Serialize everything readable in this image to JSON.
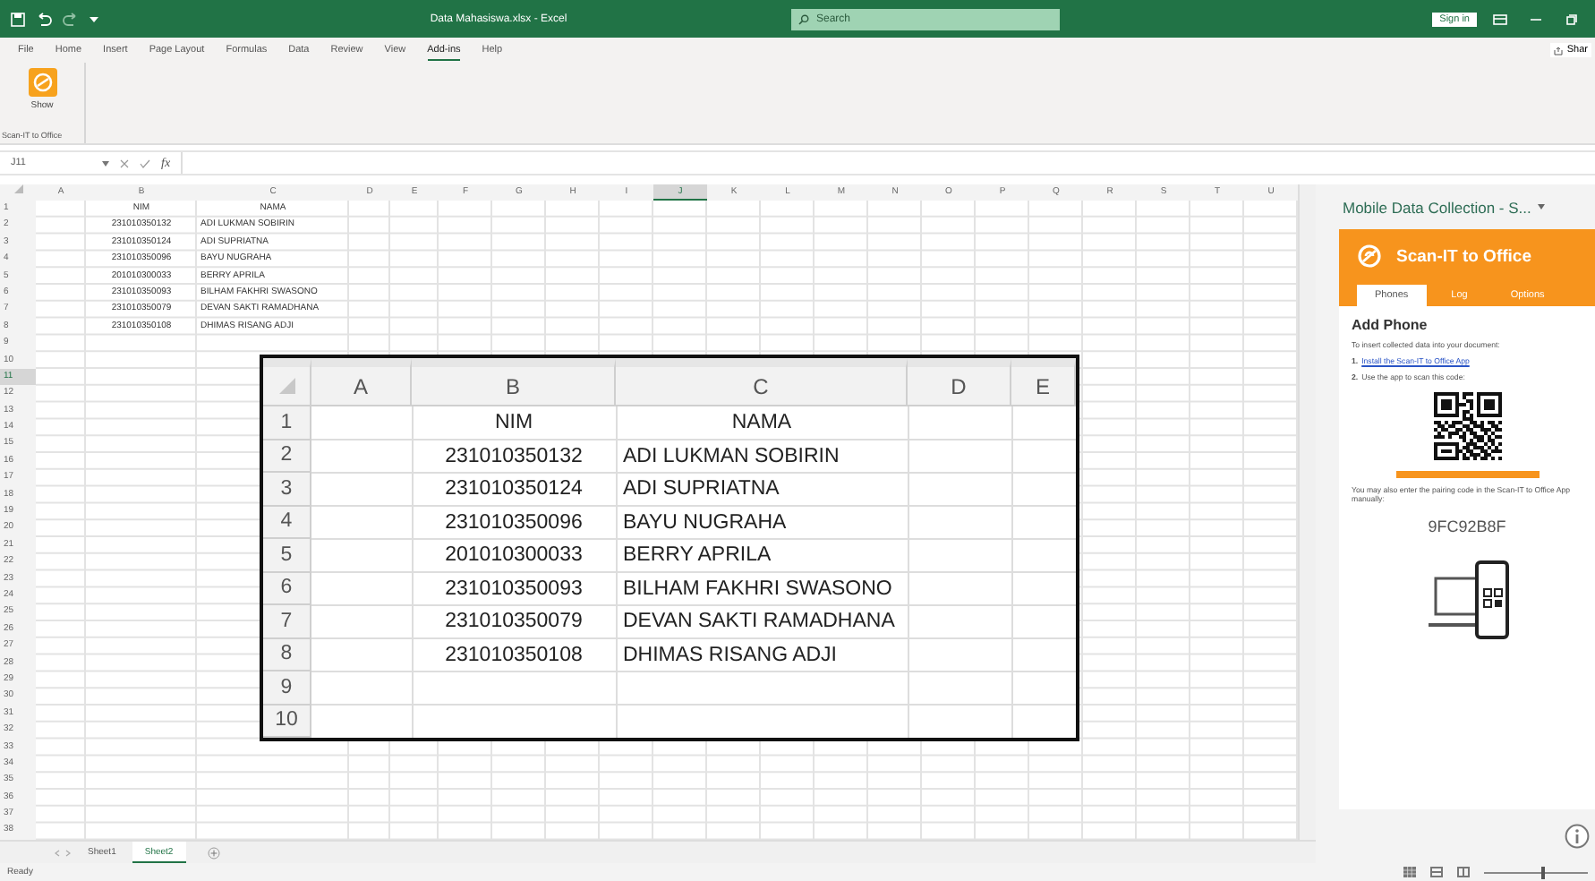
{
  "window": {
    "title": "Data Mahasiswa.xlsx - Excel",
    "search_placeholder": "Search",
    "sign_in": "Sign in"
  },
  "ribbon_tabs": [
    {
      "label": "File",
      "selected": false
    },
    {
      "label": "Home",
      "selected": false
    },
    {
      "label": "Insert",
      "selected": false
    },
    {
      "label": "Page Layout",
      "selected": false
    },
    {
      "label": "Formulas",
      "selected": false
    },
    {
      "label": "Data",
      "selected": false
    },
    {
      "label": "Review",
      "selected": false
    },
    {
      "label": "View",
      "selected": false
    },
    {
      "label": "Add-ins",
      "selected": true
    },
    {
      "label": "Help",
      "selected": false
    }
  ],
  "share": "Shar",
  "ribbon": {
    "button": "Show",
    "group": "Scan-IT to Office"
  },
  "formula_bar": {
    "name_box": "J11",
    "function_label": "fx"
  },
  "sheet": {
    "columns": [
      {
        "label": "A",
        "selected": false
      },
      {
        "label": "B",
        "selected": false
      },
      {
        "label": "C",
        "selected": false
      },
      {
        "label": "D",
        "selected": false
      },
      {
        "label": "E",
        "selected": false
      },
      {
        "label": "F",
        "selected": false
      },
      {
        "label": "G",
        "selected": false
      },
      {
        "label": "H",
        "selected": false
      },
      {
        "label": "I",
        "selected": false
      },
      {
        "label": "J",
        "selected": true
      },
      {
        "label": "K",
        "selected": false
      },
      {
        "label": "L",
        "selected": false
      },
      {
        "label": "M",
        "selected": false
      },
      {
        "label": "N",
        "selected": false
      },
      {
        "label": "O",
        "selected": false
      },
      {
        "label": "P",
        "selected": false
      },
      {
        "label": "Q",
        "selected": false
      },
      {
        "label": "R",
        "selected": false
      },
      {
        "label": "S",
        "selected": false
      },
      {
        "label": "T",
        "selected": false
      },
      {
        "label": "U",
        "selected": false
      }
    ],
    "rows": [
      {
        "number": "1",
        "selected": false,
        "cells": [
          "",
          "NIM",
          "NAMA"
        ]
      },
      {
        "number": "2",
        "selected": false,
        "cells": [
          "",
          "231010350132",
          "ADI LUKMAN SOBIRIN"
        ]
      },
      {
        "number": "3",
        "selected": false,
        "cells": [
          "",
          "231010350124",
          "ADI SUPRIATNA"
        ]
      },
      {
        "number": "4",
        "selected": false,
        "cells": [
          "",
          "231010350096",
          "BAYU NUGRAHA"
        ]
      },
      {
        "number": "5",
        "selected": false,
        "cells": [
          "",
          "201010300033",
          "BERRY APRILA"
        ]
      },
      {
        "number": "6",
        "selected": false,
        "cells": [
          "",
          "231010350093",
          "BILHAM FAKHRI SWASONO"
        ]
      },
      {
        "number": "7",
        "selected": false,
        "cells": [
          "",
          "231010350079",
          "DEVAN SAKTI RAMADHANA"
        ]
      },
      {
        "number": "8",
        "selected": false,
        "cells": [
          "",
          "231010350108",
          "DHIMAS RISANG ADJI"
        ]
      },
      {
        "number": "9",
        "selected": false
      },
      {
        "number": "10",
        "selected": false
      },
      {
        "number": "11",
        "selected": true
      },
      {
        "number": "12",
        "selected": false
      },
      {
        "number": "13",
        "selected": false
      },
      {
        "number": "14",
        "selected": false
      },
      {
        "number": "15",
        "selected": false
      },
      {
        "number": "16",
        "selected": false
      },
      {
        "number": "17",
        "selected": false
      },
      {
        "number": "18",
        "selected": false
      },
      {
        "number": "19",
        "selected": false
      },
      {
        "number": "20",
        "selected": false
      },
      {
        "number": "21",
        "selected": false
      },
      {
        "number": "22",
        "selected": false
      },
      {
        "number": "23",
        "selected": false
      },
      {
        "number": "24",
        "selected": false
      },
      {
        "number": "25",
        "selected": false
      },
      {
        "number": "26",
        "selected": false
      },
      {
        "number": "27",
        "selected": false
      },
      {
        "number": "28",
        "selected": false
      },
      {
        "number": "29",
        "selected": false
      },
      {
        "number": "30",
        "selected": false
      },
      {
        "number": "31",
        "selected": false
      },
      {
        "number": "32",
        "selected": false
      },
      {
        "number": "33",
        "selected": false
      },
      {
        "number": "34",
        "selected": false
      },
      {
        "number": "35",
        "selected": false
      },
      {
        "number": "36",
        "selected": false
      },
      {
        "number": "37",
        "selected": false
      },
      {
        "number": "38",
        "selected": false
      }
    ]
  },
  "inset": {
    "columns": [
      "A",
      "B",
      "C",
      "D",
      "E"
    ],
    "rows": [
      {
        "number": "1",
        "cells": [
          "",
          "NIM",
          "NAMA"
        ]
      },
      {
        "number": "2",
        "cells": [
          "",
          "231010350132",
          "ADI LUKMAN SOBIRIN"
        ]
      },
      {
        "number": "3",
        "cells": [
          "",
          "231010350124",
          "ADI SUPRIATNA"
        ]
      },
      {
        "number": "4",
        "cells": [
          "",
          "231010350096",
          "BAYU NUGRAHA"
        ]
      },
      {
        "number": "5",
        "cells": [
          "",
          "201010300033",
          "BERRY APRILA"
        ]
      },
      {
        "number": "6",
        "cells": [
          "",
          "231010350093",
          "BILHAM FAKHRI SWASONO"
        ]
      },
      {
        "number": "7",
        "cells": [
          "",
          "231010350079",
          "DEVAN SAKTI RAMADHANA"
        ]
      },
      {
        "number": "8",
        "cells": [
          "",
          "231010350108",
          "DHIMAS RISANG ADJI"
        ]
      },
      {
        "number": "9",
        "cells": []
      },
      {
        "number": "10",
        "cells": []
      }
    ]
  },
  "task_pane": {
    "title": "Mobile Data Collection - S...",
    "header": "Scan-IT to Office",
    "tabs": [
      {
        "label": "Phones",
        "selected": true
      },
      {
        "label": "Log",
        "selected": false
      },
      {
        "label": "Options",
        "selected": false
      }
    ],
    "heading": "Add Phone",
    "intro": "To insert collected data into your document:",
    "steps": [
      {
        "number": "1.",
        "text": "Install the Scan-IT to Office App",
        "kind": "link"
      },
      {
        "number": "2.",
        "text": "Use the app to scan this code:",
        "kind": "text"
      }
    ],
    "note": "You may also enter the pairing code in the Scan-IT to Office App manually:",
    "pairing_code": "9FC92B8F"
  },
  "sheet_tabs": [
    {
      "label": "Sheet1",
      "selected": false
    },
    {
      "label": "Sheet2",
      "selected": true
    }
  ],
  "status_bar": {
    "text": "Ready",
    "zoom": {
      "level": 0.55
    }
  }
}
